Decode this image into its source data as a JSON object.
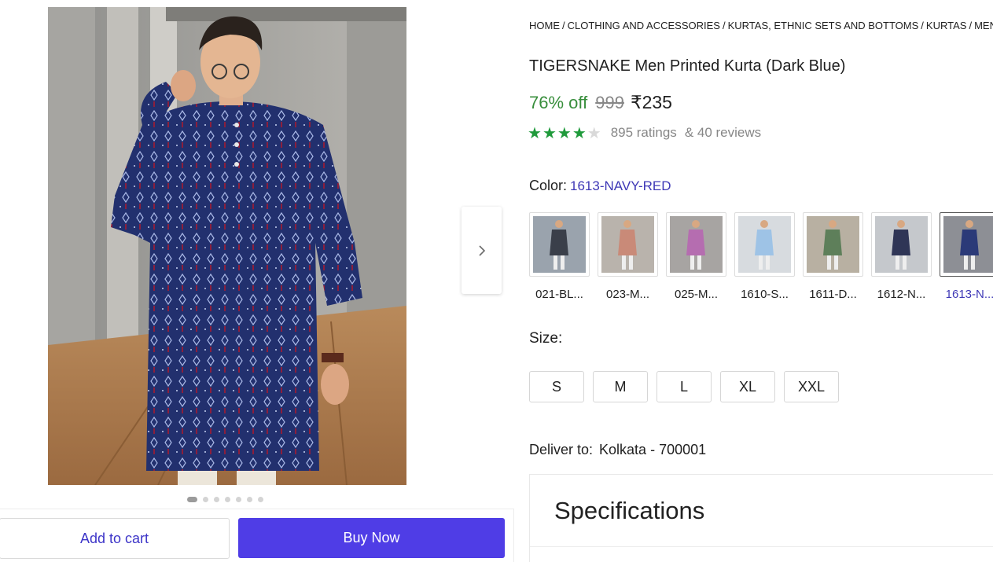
{
  "breadcrumb": [
    {
      "label": "HOME"
    },
    {
      "label": "CLOTHING AND ACCESSORIES"
    },
    {
      "label": "KURTAS, ETHNIC SETS AND BOTTOMS"
    },
    {
      "label": "KURTAS"
    },
    {
      "label": "MEN'S"
    }
  ],
  "product": {
    "title": "TIGERSNAKE Men Printed Kurta (Dark Blue)",
    "discount": "76% off",
    "mrp": "999",
    "price": "₹235",
    "rating_stars": 4,
    "rating_max": 5,
    "ratings_text": "895 ratings",
    "reviews_text": "& 40 reviews"
  },
  "color": {
    "label": "Color:",
    "selected": "1613-NAVY-RED",
    "options": [
      {
        "caption": "021-BL...",
        "kurta_color": "#3a3f4a",
        "bg_color": "#9aa3ad"
      },
      {
        "caption": "023-M...",
        "kurta_color": "#c98a78",
        "bg_color": "#b9b3ac"
      },
      {
        "caption": "025-M...",
        "kurta_color": "#b56db0",
        "bg_color": "#a7a4a2"
      },
      {
        "caption": "1610-S...",
        "kurta_color": "#9ec3e6",
        "bg_color": "#d7dbdf"
      },
      {
        "caption": "1611-D...",
        "kurta_color": "#5e7f5a",
        "bg_color": "#b8b0a2"
      },
      {
        "caption": "1612-N...",
        "kurta_color": "#2f3556",
        "bg_color": "#c5c8cc"
      },
      {
        "caption": "1613-N...",
        "kurta_color": "#2b3a78",
        "bg_color": "#8d8f95"
      }
    ],
    "selected_index": 6
  },
  "size": {
    "label": "Size:",
    "options": [
      "S",
      "M",
      "L",
      "XL",
      "XXL"
    ]
  },
  "delivery": {
    "label": "Deliver to:",
    "location": "Kolkata - 700001"
  },
  "specifications": {
    "title": "Specifications"
  },
  "gallery": {
    "image_count": 7,
    "active_index": 0
  },
  "actions": {
    "add_to_cart": "Add to cart",
    "buy_now": "Buy Now"
  },
  "colors": {
    "accent": "#4f3de6",
    "discount_green": "#388e3c",
    "star_green": "#1f9a3b",
    "link_blue": "#3e38b6"
  },
  "icons": {
    "next": "chevron-right-icon",
    "star": "star-icon"
  }
}
